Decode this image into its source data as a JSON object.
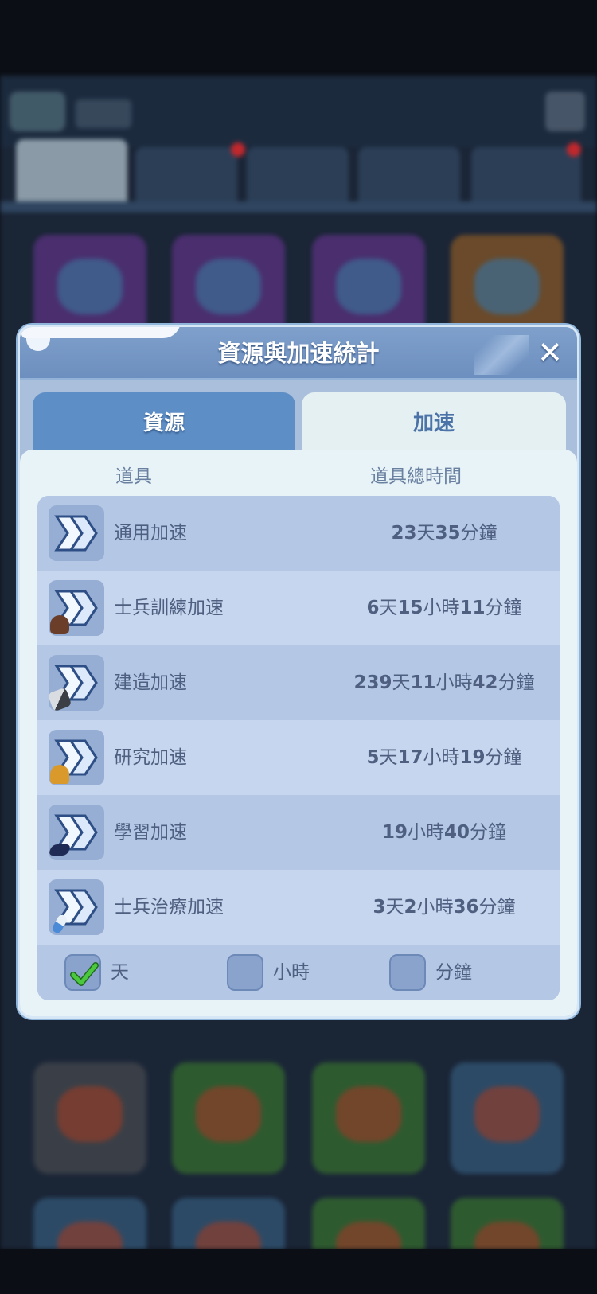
{
  "modal": {
    "title": "資源與加速統計",
    "tabs": [
      {
        "label": "資源",
        "active": false
      },
      {
        "label": "加速",
        "active": true
      }
    ],
    "columns": {
      "item": "道具",
      "total": "道具總時間"
    },
    "rows": [
      {
        "name": "通用加速",
        "time": "23天35分鐘",
        "icon": "speedup-general-icon"
      },
      {
        "name": "士兵訓練加速",
        "time": "6天15小時11分鐘",
        "icon": "speedup-training-icon"
      },
      {
        "name": "建造加速",
        "time": "239天11小時42分鐘",
        "icon": "speedup-construction-icon"
      },
      {
        "name": "研究加速",
        "time": "5天17小時19分鐘",
        "icon": "speedup-research-icon"
      },
      {
        "name": "學習加速",
        "time": "19小時40分鐘",
        "icon": "speedup-learning-icon"
      },
      {
        "name": "士兵治療加速",
        "time": "3天2小時36分鐘",
        "icon": "speedup-healing-icon"
      }
    ],
    "filters": [
      {
        "label": "天",
        "checked": true
      },
      {
        "label": "小時",
        "checked": false
      },
      {
        "label": "分鐘",
        "checked": false
      }
    ]
  },
  "colors": {
    "header": "#6d8fbf",
    "tab_active": "#e5f0f2",
    "tab_inactive": "#5e8ec6",
    "text": "#4e5f80",
    "check_green": "#3aa839"
  }
}
